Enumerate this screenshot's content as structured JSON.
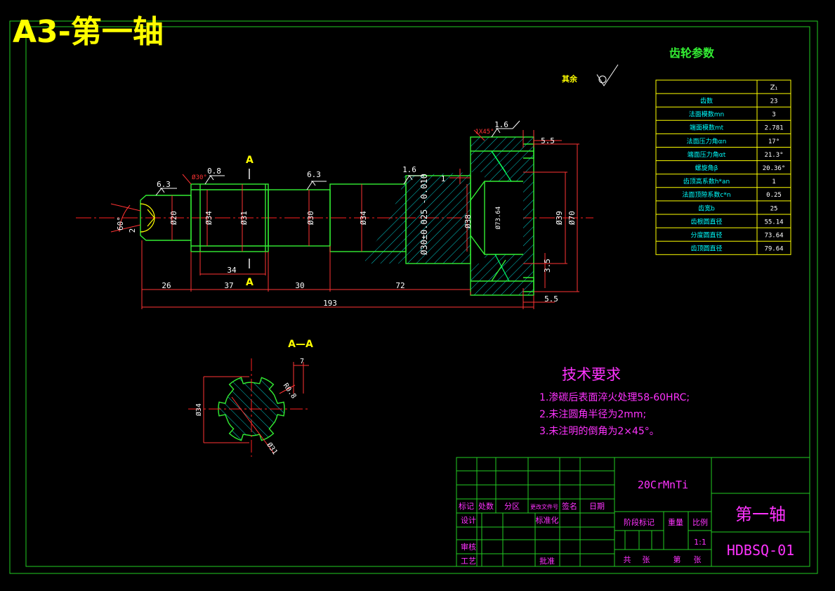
{
  "sheet_title": "A3-第一轴",
  "colors": {
    "frame": "#22cc22",
    "outline": "#33ee33",
    "dimension": "#ff3333",
    "hatch": "#00cccc",
    "text_yellow": "#ffff00",
    "text_magenta": "#ff33ff",
    "centerline": "#ff2020"
  },
  "gear_table": {
    "title": "齿轮参数",
    "column_header": "Z₁",
    "rows": [
      {
        "label": "齿数",
        "value": "23"
      },
      {
        "label": "法面模数mn",
        "value": "3"
      },
      {
        "label": "端面模数mt",
        "value": "2.781"
      },
      {
        "label": "法面压力角αn",
        "value": "17°"
      },
      {
        "label": "端面压力角αt",
        "value": "21.3°"
      },
      {
        "label": "螺旋角β",
        "value": "20.36°"
      },
      {
        "label": "齿顶高系数h*an",
        "value": "1"
      },
      {
        "label": "法面顶隙系数c*n",
        "value": "0.25"
      },
      {
        "label": "齿宽b",
        "value": "25"
      },
      {
        "label": "齿根圆直径",
        "value": "55.14"
      },
      {
        "label": "分度圆直径",
        "value": "73.64"
      },
      {
        "label": "齿顶圆直径",
        "value": "79.64"
      }
    ]
  },
  "roughness_note": "其余",
  "section_labels": {
    "cut_a_top": "A",
    "cut_a_bottom": "A",
    "section_title": "A—A"
  },
  "dims": {
    "d20": "Ø20",
    "d34a": "Ø34",
    "d31": "Ø31",
    "d30": "Ø30",
    "d34b": "Ø34",
    "d30_tol": "Ø30±0.025 -0.010",
    "d38": "Ø38",
    "d_teeth": "Ø73.64",
    "d39": "Ø39",
    "d70": "Ø70",
    "r60": "60°",
    "c2": "2",
    "len26": "26",
    "len37": "37",
    "len34": "34",
    "len30": "30",
    "len72": "72",
    "len193": "193",
    "len5_5a": "5.5",
    "len5_5b": "5.5",
    "len3_5": "3.5",
    "len1": "1",
    "chamfer1": "1X45°",
    "chamfer2": "Ø30°",
    "ra1": "6.3",
    "ra2": "0.8",
    "ra3": "6.3",
    "ra4": "1.6",
    "ra5": "1.6",
    "sec_w": "7",
    "sec_d34": "Ø34",
    "sec_d31": "Ø31",
    "sec_r": "R0.8"
  },
  "tech_requirements": {
    "title": "技术要求",
    "items": [
      "1.渗碳后表面淬火处理58-60HRC;",
      "2.未注圆角半径为2mm;",
      "3.未注明的倒角为2×45°。"
    ]
  },
  "title_block": {
    "material": "20CrMnTi",
    "part_name": "第一轴",
    "drawing_no": "HDBSQ-01",
    "headers": [
      "标记",
      "处数",
      "分区",
      "更改文件号",
      "签名",
      "日期"
    ],
    "design": "设计",
    "standardization": "标准化",
    "review": "审核",
    "process": "工艺",
    "approve": "批准",
    "stage_mark": "阶段标记",
    "weight": "重量",
    "scale_label": "比例",
    "scale": "1:1",
    "total": "共",
    "sheets": "张",
    "sheet_no": "第",
    "sheet_unit": "张"
  }
}
